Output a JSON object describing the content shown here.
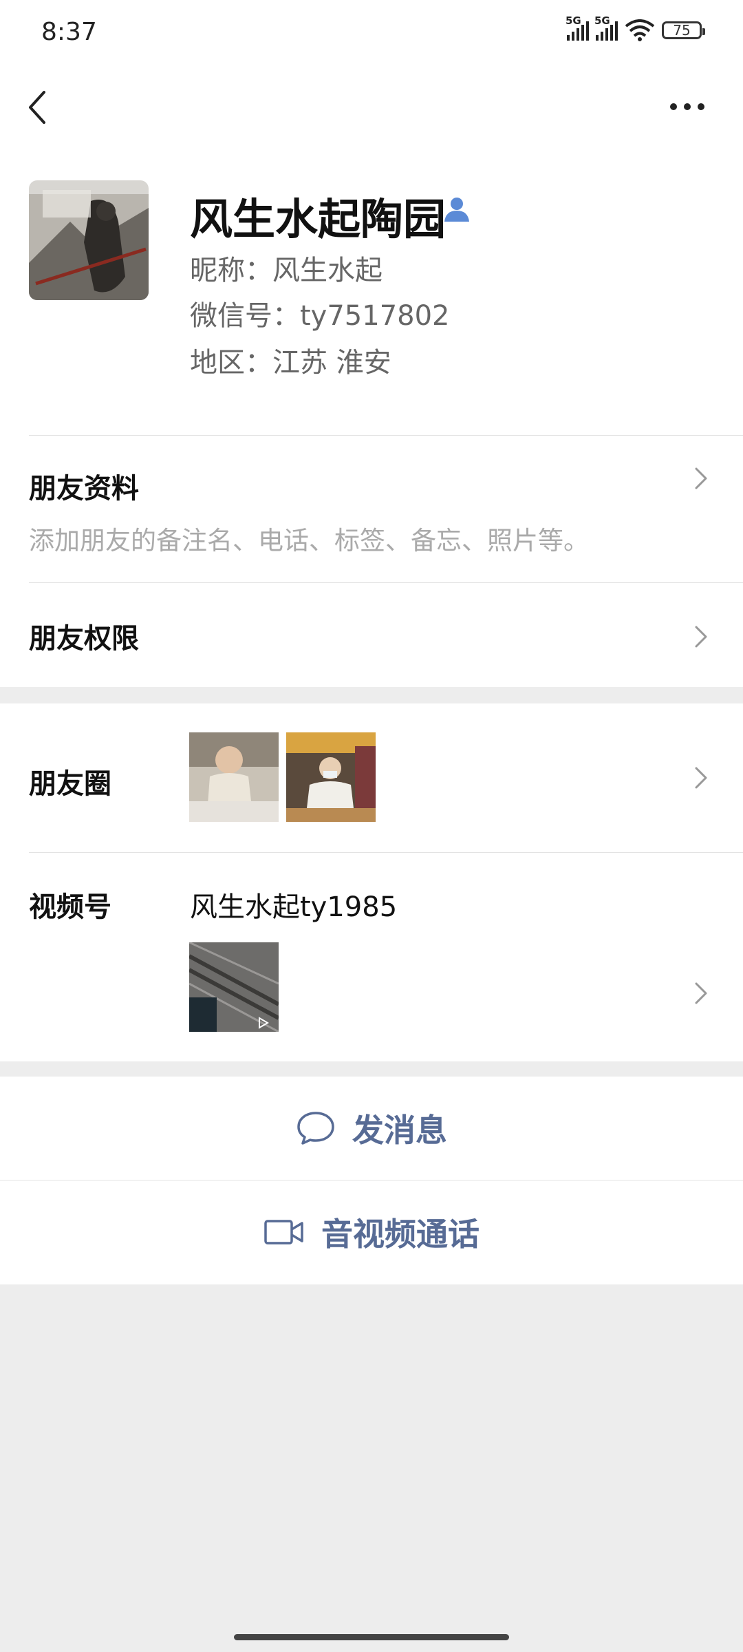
{
  "status_bar": {
    "time": "8:37",
    "network1": "5G",
    "network2": "5G",
    "battery": "75"
  },
  "profile": {
    "name": "风生水起陶园",
    "nickname": "昵称：风生水起",
    "wechat_id": "微信号：ty7517802",
    "region": "地区：江苏  淮安"
  },
  "friend_info": {
    "label": "朋友资料",
    "subtitle": "添加朋友的备注名、电话、标签、备忘、照片等。"
  },
  "friend_permission": {
    "label": "朋友权限"
  },
  "moments": {
    "label": "朋友圈"
  },
  "channels": {
    "label": "视频号",
    "name": "风生水起ty1985"
  },
  "actions": {
    "message": "发消息",
    "call": "音视频通话"
  },
  "colors": {
    "link": "#576b95",
    "accent_icon": "#5b8ad6"
  },
  "icons": [
    "back-arrow-icon",
    "more-icon",
    "person-icon",
    "chevron-right-icon",
    "chat-bubble-icon",
    "video-camera-icon"
  ]
}
